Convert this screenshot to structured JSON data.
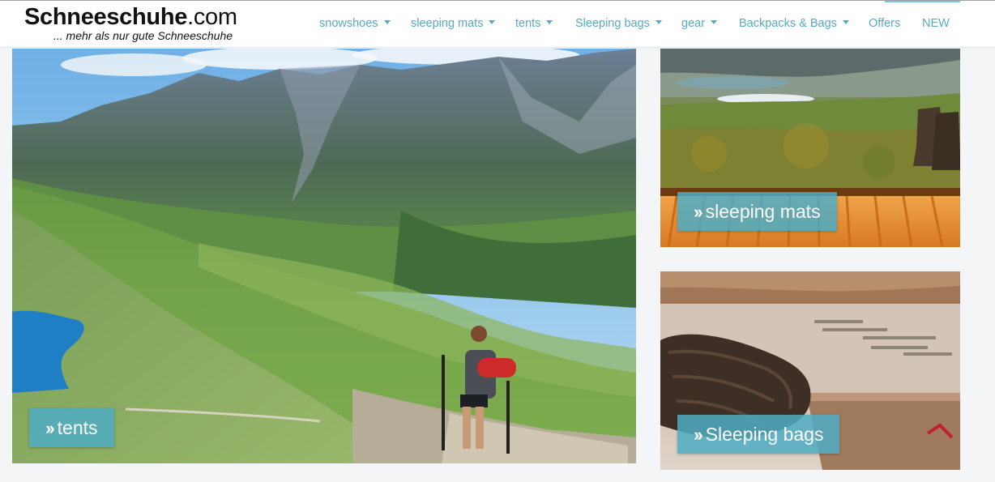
{
  "header": {
    "logo_main": "Schneeschuhe",
    "logo_suffix": ".com",
    "logo_tagline": "... mehr als nur gute Schneeschuhe"
  },
  "nav": {
    "items": [
      {
        "label": "snowshoes",
        "dropdown": true
      },
      {
        "label": "sleeping mats",
        "dropdown": true
      },
      {
        "label": "tents",
        "dropdown": true
      },
      {
        "label": "Sleeping bags",
        "dropdown": true
      },
      {
        "label": "gear",
        "dropdown": true
      },
      {
        "label": "Backpacks & Bags",
        "dropdown": true
      },
      {
        "label": "Offers",
        "dropdown": false
      },
      {
        "label": "NEW",
        "dropdown": false
      }
    ]
  },
  "tiles": {
    "tents": {
      "label": "tents",
      "icon": "double-chevron-right-icon"
    },
    "sleeping_mats": {
      "label": "sleeping mats",
      "icon": "double-chevron-right-icon"
    },
    "sleeping_bags": {
      "label": "Sleeping bags",
      "icon": "double-chevron-right-icon"
    }
  },
  "colors": {
    "nav_link": "#5aa9bf",
    "label_bg": "#4fabc4",
    "page_bg": "#f4f5f7"
  }
}
